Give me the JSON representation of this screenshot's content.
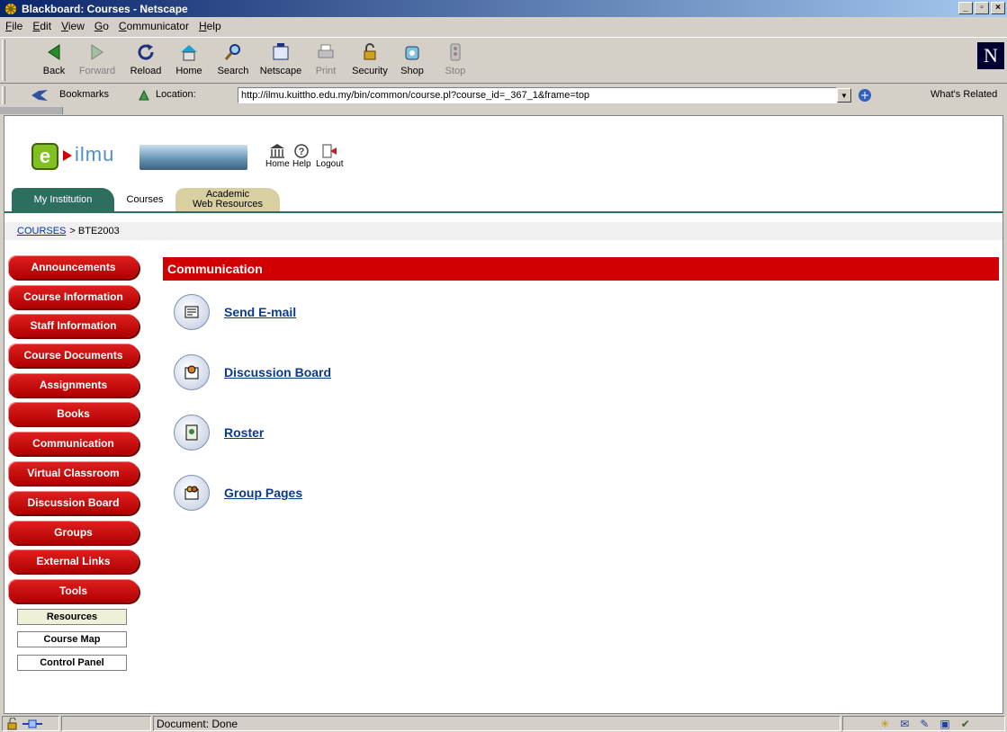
{
  "window": {
    "title": "Blackboard: Courses - Netscape"
  },
  "menu": [
    "File",
    "Edit",
    "View",
    "Go",
    "Communicator",
    "Help"
  ],
  "toolbar": {
    "back": "Back",
    "forward": "Forward",
    "reload": "Reload",
    "home": "Home",
    "search": "Search",
    "netscape": "Netscape",
    "print": "Print",
    "security": "Security",
    "shop": "Shop",
    "stop": "Stop"
  },
  "location": {
    "bookmarks": "Bookmarks",
    "label": "Location:",
    "url": "http://ilmu.kuittho.edu.my/bin/common/course.pl?course_id=_367_1&frame=top",
    "whats_related": "What's Related"
  },
  "header": {
    "logo_text": "ilmu",
    "home": "Home",
    "help": "Help",
    "logout": "Logout"
  },
  "tabs": {
    "my_institution": "My Institution",
    "courses": "Courses",
    "academic_line1": "Academic",
    "academic_line2": "Web Resources"
  },
  "breadcrumb": {
    "courses": "COURSES",
    "current": "> BTE2003"
  },
  "nav": {
    "items": [
      "Announcements",
      "Course Information",
      "Staff Information",
      "Course Documents",
      "Assignments",
      "Books",
      "Communication",
      "Virtual Classroom",
      "Discussion Board",
      "Groups",
      "External Links",
      "Tools"
    ],
    "tools": [
      "Resources",
      "Course Map",
      "Control Panel"
    ]
  },
  "main": {
    "title": "Communication",
    "links": [
      "Send E-mail",
      "Discussion Board",
      "Roster",
      "Group Pages"
    ]
  },
  "status": {
    "text": "Document: Done"
  },
  "colors": {
    "accent": "#d00000",
    "link": "#0b3a8c",
    "chrome": "#d4d0c8",
    "titlebar": "#0a246a"
  }
}
